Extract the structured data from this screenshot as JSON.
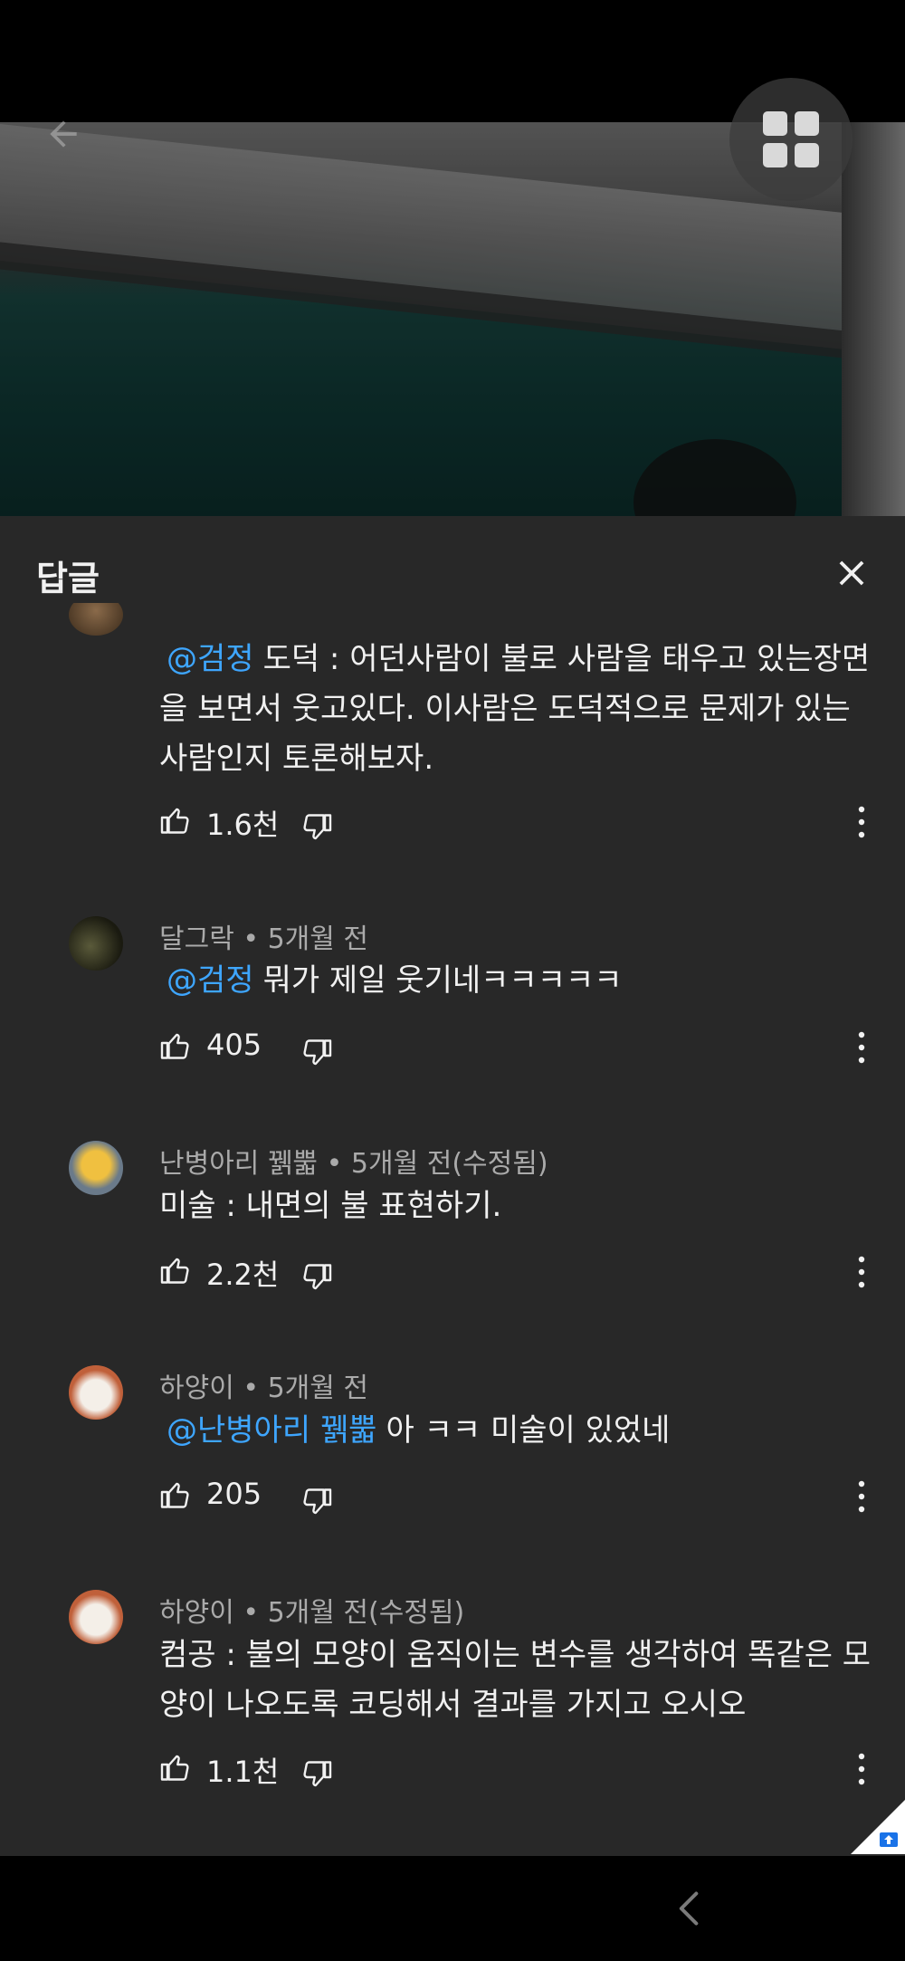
{
  "panel": {
    "title": "답글"
  },
  "comments": [
    {
      "mention": "@검정",
      "text": "도덕 : 어던사람이 불로 사람을 태우고 있는장면을 보면서 웃고있다. 이사람은 도덕적으로 문제가 있는사람인지 토론해보자.",
      "likes": "1.6천"
    },
    {
      "author": "달그락",
      "meta": "달그락 • 5개월 전",
      "mention": "@검정",
      "text": "뭐가 제일 웃기네ㅋㅋㅋㅋㅋ",
      "likes": "405"
    },
    {
      "author": "난병아리 꿹뿗",
      "meta": "난병아리 꿹뿗 • 5개월 전(수정됨)",
      "text": "미술 : 내면의 불 표현하기.",
      "likes": "2.2천"
    },
    {
      "author": "하양이",
      "meta": "하양이 • 5개월 전",
      "mention": "@난병아리 꿹뿗",
      "text": "아 ㅋㅋ 미술이 있었네",
      "likes": "205"
    },
    {
      "author": "하양이",
      "meta": "하양이 • 5개월 전(수정됨)",
      "text": "컴공 : 불의 모양이 움직이는 변수를 생각하여 똑같은 모양이 나오도록 코딩해서 결과를 가지고 오시오",
      "likes": "1.1천"
    }
  ],
  "colors": {
    "background": "#282828",
    "text": "#f1f1f1",
    "meta": "#aaaaaa",
    "mention": "#3ea6ff"
  },
  "icons": [
    "back-arrow-icon",
    "grid-menu-icon",
    "close-icon",
    "thumb-up-icon",
    "thumb-down-icon",
    "more-vert-icon",
    "nav-back-icon"
  ]
}
